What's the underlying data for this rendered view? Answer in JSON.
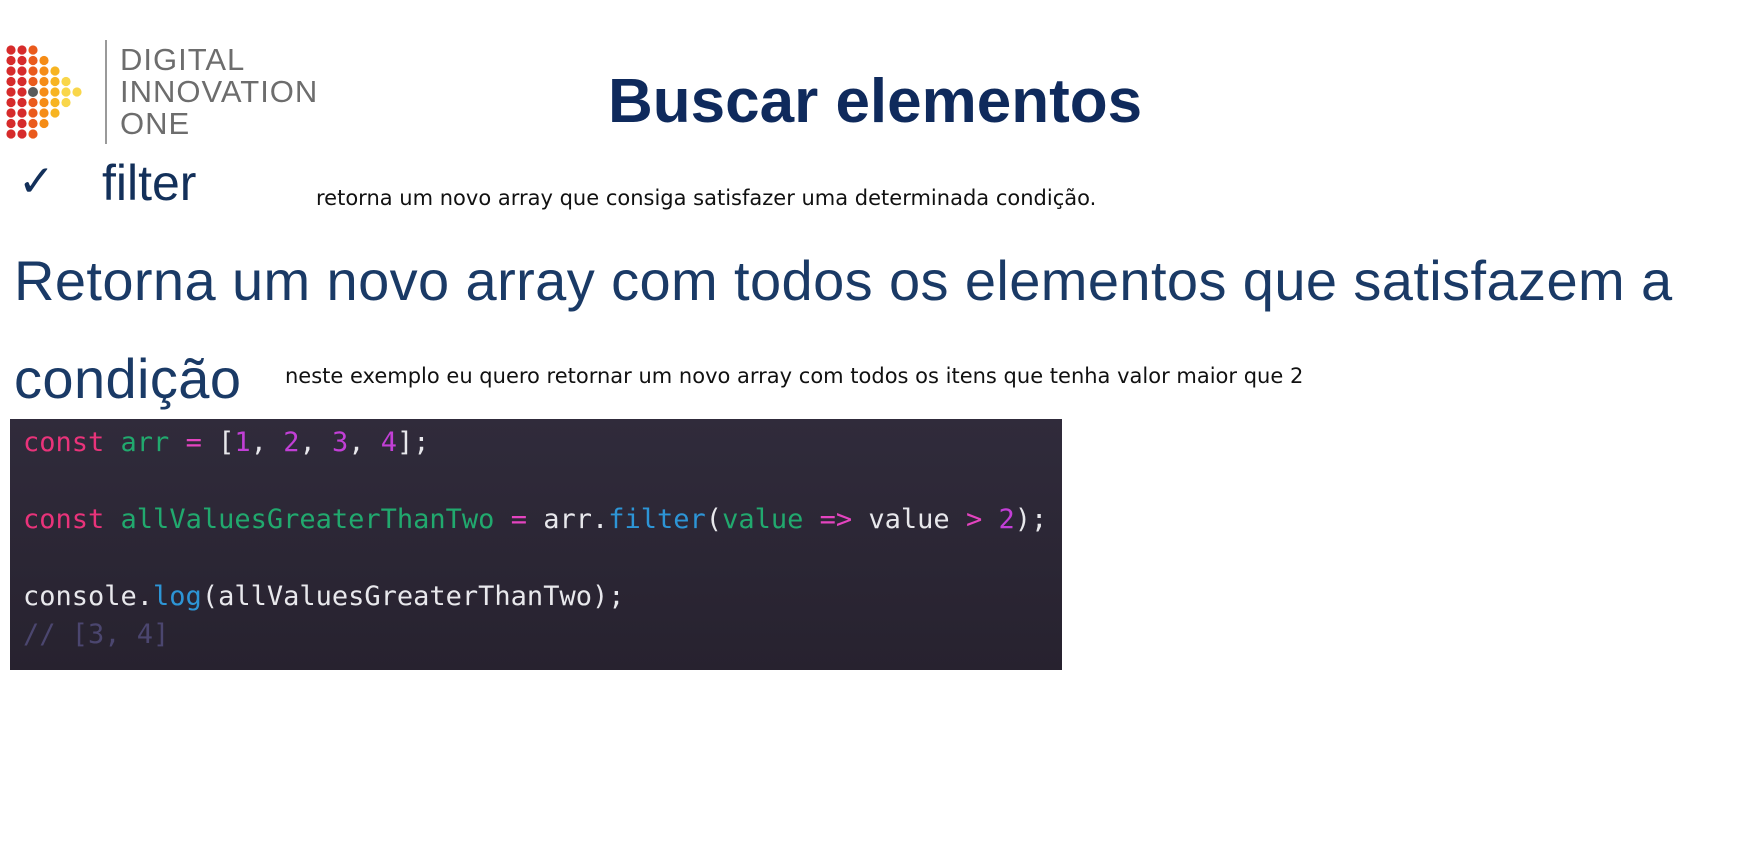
{
  "logo": {
    "lines": [
      "DIGITAL",
      "INNOVATION",
      "ONE"
    ],
    "dot_colors": [
      "#d62b2b",
      "#ea5a1c",
      "#f58c16",
      "#f7b421",
      "#f9d64a"
    ]
  },
  "slide": {
    "title": "Buscar elementos",
    "check_glyph": "✓",
    "method": "filter",
    "description_line1": "Retorna um novo array com todos os elementos que satisfazem a",
    "description_line2": "condição"
  },
  "notes": {
    "note1": "retorna um novo array que consiga satisfazer uma determinada condição.",
    "note2": "neste exemplo eu quero retornar um novo array com todos os itens que tenha valor maior que 2"
  },
  "code": {
    "line1": {
      "kw": "const",
      "var": "arr",
      "op": "=",
      "open": "[",
      "n1": "1",
      "n2": "2",
      "n3": "3",
      "n4": "4",
      "comma": ",",
      "close": "];"
    },
    "line2": {
      "kw": "const",
      "var": "allValuesGreaterThanTwo",
      "op": "=",
      "obj": "arr.",
      "method": "filter",
      "paren": "(",
      "param": "value",
      "arrow": "=>",
      "body": "value",
      "gt": ">",
      "num": "2",
      "end": ");"
    },
    "line3": {
      "obj": "console.",
      "method": "log",
      "args": "(allValuesGreaterThanTwo);"
    },
    "comment": "// [3, 4]"
  },
  "colors": {
    "title": "#0f2a5c",
    "code_background": "#2d2838",
    "keyword": "#e9337a",
    "variable": "#21a96e",
    "number": "#c23fd6",
    "function": "#2d95d6",
    "comment": "#4b466f"
  }
}
